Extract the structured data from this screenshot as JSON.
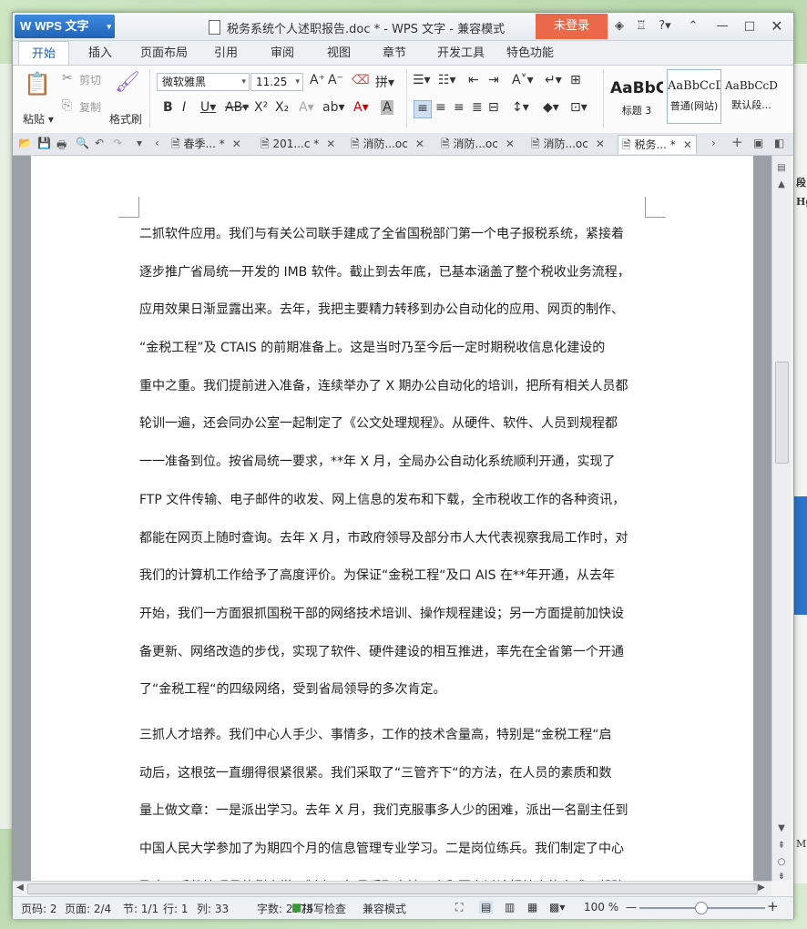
{
  "app": {
    "name": "WPS 文字",
    "title": "税务系统个人述职报告.doc * - WPS 文字 - 兼容模式",
    "login": "未登录"
  },
  "ribbon_tabs": [
    "开始",
    "插入",
    "页面布局",
    "引用",
    "审阅",
    "视图",
    "章节",
    "开发工具",
    "特色功能"
  ],
  "ribbon": {
    "paste": "粘贴",
    "cut": "剪切",
    "copy": "复制",
    "format_painter": "格式刷",
    "font_name": "微软雅黑",
    "font_size": "11.25",
    "styles": [
      {
        "sample": "AaBbC",
        "label": "标题 3"
      },
      {
        "sample": "AaBbCcD",
        "label": "普通(网站)"
      },
      {
        "sample": "AaBbCcDd",
        "label": "默认段..."
      }
    ]
  },
  "doc_tabs": [
    "春季... *",
    "201...c *",
    "消防...oc",
    "消防...oc",
    "消防...oc",
    "税务... *"
  ],
  "document": {
    "paragraph1": [
      "二抓软件应用。我们与有关公司联手建成了全省国税部门第一个电子报税系统，紧接着",
      "逐步推广省局统一开发的 IMB 软件。截止到去年底，已基本涵盖了整个税收业务流程，",
      "应用效果日渐显露出来。去年，我把主要精力转移到办公自动化的应用、网页的制作、",
      "“金税工程”及 CTAIS 的前期准备上。这是当时乃至今后一定时期税收信息化建设的",
      "重中之重。我们提前进入准备，连续举办了 X 期办公自动化的培训，把所有相关人员都",
      "轮训一遍，还会同办公室一起制定了《公文处理规程》。从硬件、软件、人员到规程都",
      "一一准备到位。按省局统一要求，**年 X 月，全局办公自动化系统顺利开通，实现了",
      "FTP 文件传输、电子邮件的收发、网上信息的发布和下载，全市税收工作的各种资讯，",
      "都能在网页上随时查询。去年 X 月，市政府领导及部分市人大代表视察我局工作时，对",
      "我们的计算机工作给予了高度评价。为保证“金税工程“及口 AIS 在**年开通，从去年",
      "开始，我们一方面狠抓国税干部的网络技术培训、操作规程建设；另一方面提前加快设",
      "备更新、网络改造的步伐，实现了软件、硬件建设的相互推进，率先在全省第一个开通",
      "了“金税工程“的四级网络，受到省局领导的多次肯定。"
    ],
    "paragraph2": [
      "三抓人才培养。我们中心人手少、事情多，工作的技术含量高，特别是“金税工程“启",
      "动后，这根弦一直绷得很紧很紧。我们采取了“三管齐下“的方法，在人员的素质和数",
      "量上做文章：一是派出学习。去年 X 月，我们克服事多人少的困难，派出一名副主任到",
      "中国人民大学参加了为期四个月的信息管理专业学习。二是岗位练兵。我们制定了中心",
      "及大厅系统管理员的例会学习制度，每月采取实地开会和网上讨论相结合的方式，帮助"
    ]
  },
  "status": {
    "page_num": "页码: 2",
    "pages": "页面: 2/4",
    "section": "节: 1/1",
    "row": "行: 1",
    "column": "列: 33",
    "word_count": "字数: 2575",
    "spell_check": "拼写检查",
    "mode": "兼容模式",
    "zoom": "100 %"
  },
  "desktop_side": {
    "right_1": "段",
    "right_2": "Hg",
    "right_3": "MB"
  }
}
